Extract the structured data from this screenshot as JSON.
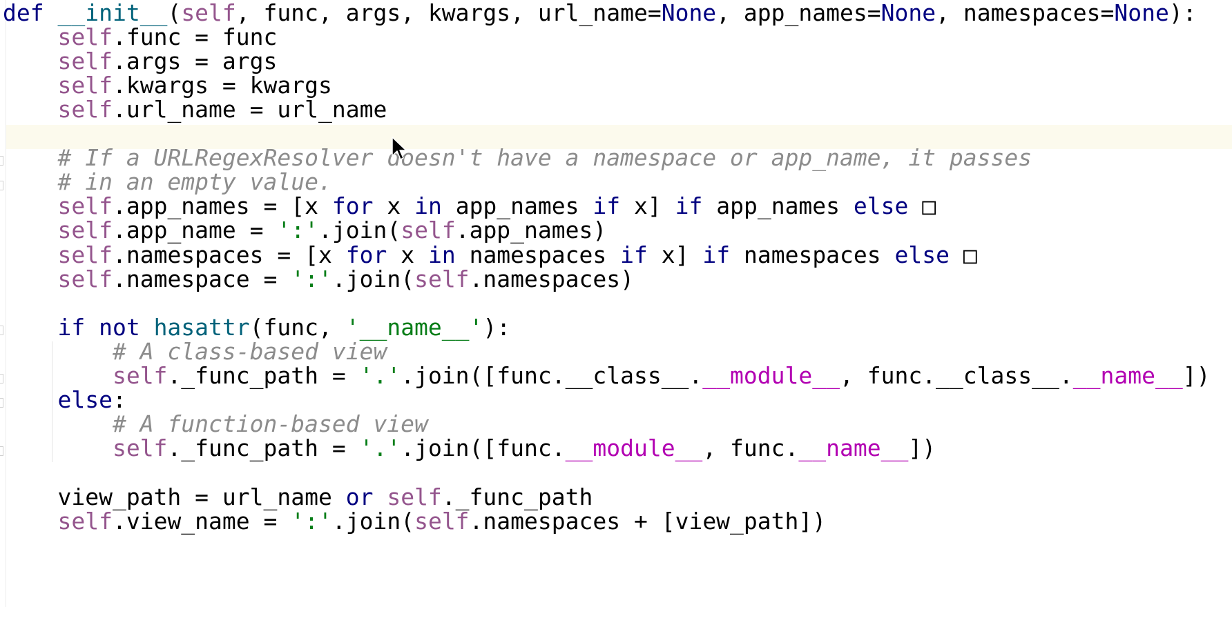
{
  "editor": {
    "language": "python",
    "colors": {
      "background": "#ffffff",
      "current_line": "#fcfaed",
      "keyword": "#000080",
      "self": "#94558d",
      "function_name": "#00627a",
      "string": "#067d17",
      "comment": "#8c8c8c",
      "dunder": "#b200b2"
    },
    "current_line_index": 5,
    "lines": [
      [
        {
          "t": "def ",
          "c": "kw"
        },
        {
          "t": "__init__",
          "c": "fn"
        },
        {
          "t": "(",
          "c": "op"
        },
        {
          "t": "self",
          "c": "self"
        },
        {
          "t": ", func, args, kwargs, url_name=",
          "c": "id"
        },
        {
          "t": "None",
          "c": "kw"
        },
        {
          "t": ", app_names=",
          "c": "id"
        },
        {
          "t": "None",
          "c": "kw"
        },
        {
          "t": ", namespaces=",
          "c": "id"
        },
        {
          "t": "None",
          "c": "kw"
        },
        {
          "t": "):",
          "c": "op"
        }
      ],
      [
        {
          "t": "    ",
          "c": "id"
        },
        {
          "t": "self",
          "c": "self"
        },
        {
          "t": ".func = func",
          "c": "id"
        }
      ],
      [
        {
          "t": "    ",
          "c": "id"
        },
        {
          "t": "self",
          "c": "self"
        },
        {
          "t": ".args = args",
          "c": "id"
        }
      ],
      [
        {
          "t": "    ",
          "c": "id"
        },
        {
          "t": "self",
          "c": "self"
        },
        {
          "t": ".kwargs = kwargs",
          "c": "id"
        }
      ],
      [
        {
          "t": "    ",
          "c": "id"
        },
        {
          "t": "self",
          "c": "self"
        },
        {
          "t": ".url_name = url_name",
          "c": "id"
        }
      ],
      [],
      [
        {
          "t": "    ",
          "c": "id"
        },
        {
          "t": "# If a URLRegexResolver doesn't have a namespace or app_name, it passes",
          "c": "cm"
        }
      ],
      [
        {
          "t": "    ",
          "c": "id"
        },
        {
          "t": "# in an empty value.",
          "c": "cm"
        }
      ],
      [
        {
          "t": "    ",
          "c": "id"
        },
        {
          "t": "self",
          "c": "self"
        },
        {
          "t": ".app_names = [x ",
          "c": "id"
        },
        {
          "t": "for",
          "c": "kw"
        },
        {
          "t": " x ",
          "c": "id"
        },
        {
          "t": "in",
          "c": "kw"
        },
        {
          "t": " app_names ",
          "c": "id"
        },
        {
          "t": "if",
          "c": "kw"
        },
        {
          "t": " x] ",
          "c": "id"
        },
        {
          "t": "if",
          "c": "kw"
        },
        {
          "t": " app_names ",
          "c": "id"
        },
        {
          "t": "else",
          "c": "kw"
        },
        {
          "t": " □",
          "c": "box-char"
        }
      ],
      [
        {
          "t": "    ",
          "c": "id"
        },
        {
          "t": "self",
          "c": "self"
        },
        {
          "t": ".app_name = ",
          "c": "id"
        },
        {
          "t": "':'",
          "c": "str"
        },
        {
          "t": ".join(",
          "c": "id"
        },
        {
          "t": "self",
          "c": "self"
        },
        {
          "t": ".app_names)",
          "c": "id"
        }
      ],
      [
        {
          "t": "    ",
          "c": "id"
        },
        {
          "t": "self",
          "c": "self"
        },
        {
          "t": ".namespaces = [x ",
          "c": "id"
        },
        {
          "t": "for",
          "c": "kw"
        },
        {
          "t": " x ",
          "c": "id"
        },
        {
          "t": "in",
          "c": "kw"
        },
        {
          "t": " namespaces ",
          "c": "id"
        },
        {
          "t": "if",
          "c": "kw"
        },
        {
          "t": " x] ",
          "c": "id"
        },
        {
          "t": "if",
          "c": "kw"
        },
        {
          "t": " namespaces ",
          "c": "id"
        },
        {
          "t": "else",
          "c": "kw"
        },
        {
          "t": " □",
          "c": "box-char"
        }
      ],
      [
        {
          "t": "    ",
          "c": "id"
        },
        {
          "t": "self",
          "c": "self"
        },
        {
          "t": ".namespace = ",
          "c": "id"
        },
        {
          "t": "':'",
          "c": "str"
        },
        {
          "t": ".join(",
          "c": "id"
        },
        {
          "t": "self",
          "c": "self"
        },
        {
          "t": ".namespaces)",
          "c": "id"
        }
      ],
      [],
      [
        {
          "t": "    ",
          "c": "id"
        },
        {
          "t": "if not ",
          "c": "kw"
        },
        {
          "t": "hasattr",
          "c": "fn"
        },
        {
          "t": "(func, ",
          "c": "id"
        },
        {
          "t": "'__name__'",
          "c": "str"
        },
        {
          "t": "):",
          "c": "id"
        }
      ],
      [
        {
          "t": "        ",
          "c": "id"
        },
        {
          "t": "# A class-based view",
          "c": "cm"
        }
      ],
      [
        {
          "t": "        ",
          "c": "id"
        },
        {
          "t": "self",
          "c": "self"
        },
        {
          "t": "._func_path = ",
          "c": "id"
        },
        {
          "t": "'.'",
          "c": "str"
        },
        {
          "t": ".join([func.__class__.",
          "c": "id"
        },
        {
          "t": "__module__",
          "c": "dunder"
        },
        {
          "t": ", func.__class__.",
          "c": "id"
        },
        {
          "t": "__name__",
          "c": "dunder"
        },
        {
          "t": "])",
          "c": "id"
        }
      ],
      [
        {
          "t": "    ",
          "c": "id"
        },
        {
          "t": "else",
          "c": "kw"
        },
        {
          "t": ":",
          "c": "id"
        }
      ],
      [
        {
          "t": "        ",
          "c": "id"
        },
        {
          "t": "# A function-based view",
          "c": "cm"
        }
      ],
      [
        {
          "t": "        ",
          "c": "id"
        },
        {
          "t": "self",
          "c": "self"
        },
        {
          "t": "._func_path = ",
          "c": "id"
        },
        {
          "t": "'.'",
          "c": "str"
        },
        {
          "t": ".join([func.",
          "c": "id"
        },
        {
          "t": "__module__",
          "c": "dunder"
        },
        {
          "t": ", func.",
          "c": "id"
        },
        {
          "t": "__name__",
          "c": "dunder"
        },
        {
          "t": "])",
          "c": "id"
        }
      ],
      [],
      [
        {
          "t": "    ",
          "c": "id"
        },
        {
          "t": "view_path = url_name ",
          "c": "id"
        },
        {
          "t": "or ",
          "c": "kw"
        },
        {
          "t": "self",
          "c": "self"
        },
        {
          "t": "._func_path",
          "c": "id"
        }
      ],
      [
        {
          "t": "    ",
          "c": "id"
        },
        {
          "t": "self",
          "c": "self"
        },
        {
          "t": ".view_name = ",
          "c": "id"
        },
        {
          "t": "':'",
          "c": "str"
        },
        {
          "t": ".join(",
          "c": "id"
        },
        {
          "t": "self",
          "c": "self"
        },
        {
          "t": ".namespaces + [view_path])",
          "c": "id"
        }
      ]
    ]
  }
}
